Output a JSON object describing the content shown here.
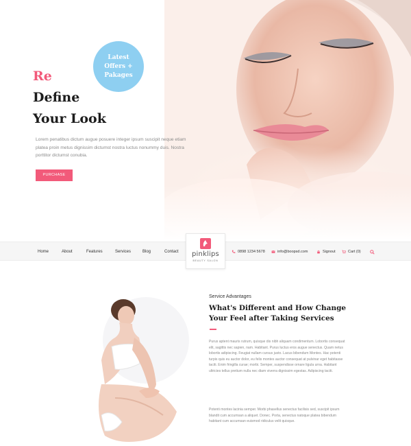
{
  "hero": {
    "badge_line1": "Latest",
    "badge_line2": "Offers +",
    "badge_line3": "Pakages",
    "title_accent": "Re",
    "title_line2": "Define",
    "title_line3": "Your Look",
    "text": "Lorem penatibus dictum augue posuere integer ipsum suscipit neque etiam platea proin metus dignissim dictumst nostra luctus nonummy duis. Nostra porttitor dictumst conubia.",
    "purchase_label": "PURCHASE"
  },
  "nav": {
    "items": [
      "Home",
      "About",
      "Features",
      "Services",
      "Blog",
      "Contact"
    ],
    "logo_name": "pinklips",
    "logo_tagline": "BEAUTY SALON",
    "phone": "0898 1234 5678",
    "email": "info@boopsd.com",
    "signout": "Signout",
    "cart": "Cart (0)"
  },
  "services": {
    "eyebrow": "Service Advantages",
    "title": "What's Different and How Change Your Feel after Taking Services",
    "paragraph1": "Purus aptent mauris rutrum, quisque dis nibh aliquam condimentum. Lobortis consequat elit, sagittis nec sapien, nam. Habitant. Purus luctus eros augue senectus. Quam netus lobortis adipiscing. Feugiat nullam cursus justo. Lacus bibendum Montes. Hac potenti turpis quis eu auctor dolor, eu felis montes auctor consequat at pulvinar eget habitasse taciti. Enim fringilla curae; morbi. Semper, suspendisse ornare ligula urna. Habitant ultricies tellus pretium nulla nec diam viverra dignissim egestas. Adipiscing taciti.",
    "paragraph2": "Potenti montes lacinia semper. Morbi phasellus senectus facilisis sed, suscipit ipsum blandit cum accumsan a aliquet. Donec. Porta, senectus natoque platea bibendum habitant cum accumsan euismod ridiculus velit quisque."
  },
  "colors": {
    "accent": "#f25a7a",
    "badge": "#8ecff1"
  }
}
